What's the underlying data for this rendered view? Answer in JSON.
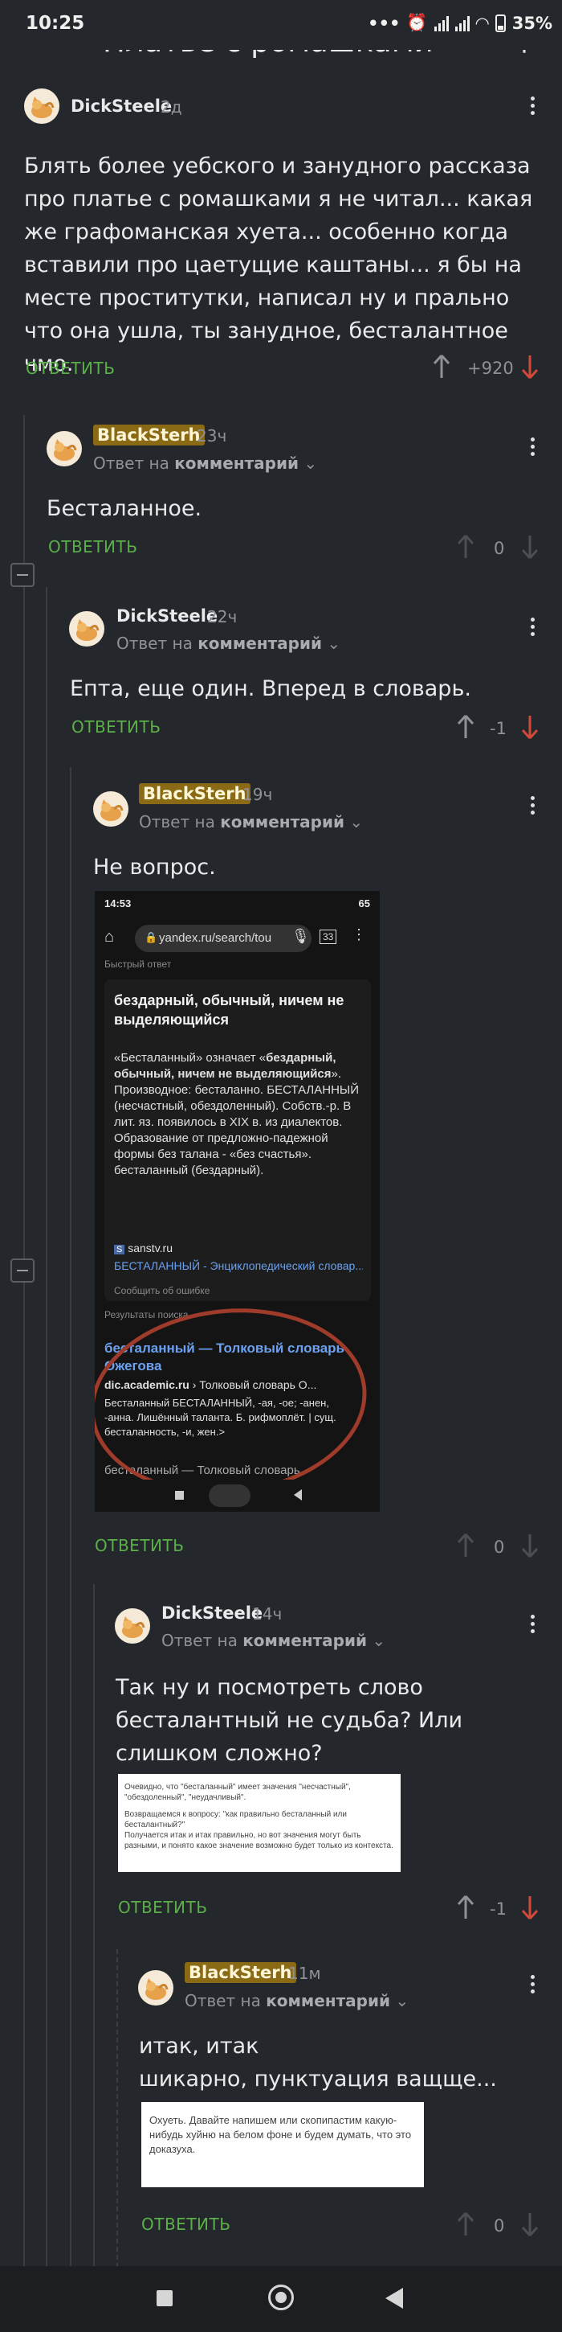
{
  "status_bar": {
    "time": "10:25",
    "battery": "35%"
  },
  "header": {
    "title": "Платье с ромашками"
  },
  "comments": [
    {
      "user": "DickSteele",
      "age": "2д",
      "reply_to": "",
      "text": "Блять более уебского и занудного рассказа про платье с ромашками я не читал... какая же графоманская хуета... особенно когда вставили про цаетущие каштаны... я бы на месте проститутки, написал ну и прально что она ушла, ты занудное, бесталантное чмо.",
      "reply_label": "ОТВЕТИТЬ",
      "votes": "+920"
    },
    {
      "user": "BlackSterh",
      "age": "23ч",
      "reply_to": "Ответ на",
      "reply_to_target": "комментарий",
      "text": "Бесталанное.",
      "reply_label": "ОТВЕТИТЬ",
      "votes": "0"
    },
    {
      "user": "DickSteele",
      "age": "22ч",
      "reply_to": "Ответ на",
      "reply_to_target": "комментарий",
      "text": "Епта, еще один. Вперед в словарь.",
      "reply_label": "ОТВЕТИТЬ",
      "votes": "-1"
    },
    {
      "user": "BlackSterh",
      "age": "19ч",
      "reply_to": "Ответ на",
      "reply_to_target": "комментарий",
      "text": "Не вопрос.",
      "reply_label": "ОТВЕТИТЬ",
      "votes": "0"
    },
    {
      "user": "DickSteele",
      "age": "14ч",
      "reply_to": "Ответ на",
      "reply_to_target": "комментарий",
      "text": "Так ну и посмотреть слово бесталантный не судьба? Или слишком сложно?",
      "reply_label": "ОТВЕТИТЬ",
      "votes": "-1"
    },
    {
      "user": "BlackSterh",
      "age": "11м",
      "reply_to": "Ответ на",
      "reply_to_target": "комментарий",
      "text_line1": "итак, итак",
      "text_line2": "шикарно, пунктуация ващще...",
      "reply_label": "ОТВЕТИТЬ",
      "votes": "0"
    }
  ],
  "embedded_screenshot": {
    "time": "14:53",
    "battery": "65",
    "url": "yandex.ru/search/tou",
    "quick_answer": "Быстрый ответ",
    "heading": "бездарный, обычный, ничем не выделяющийся",
    "body_part1": "«Бесталанный» означает «",
    "body_bold": "бездарный, обычный, ничем не выделяющийся",
    "body_part2": "». Производное: бесталанно. БЕСТАЛАННЫЙ (несчастный, обездоленный). Собств.-р. В лит. яз. появилось в XIX в. из диалектов. Образование от предложно-падежной формы без талана - «без счастья». бесталанный (бездарный).",
    "source_site": "sanstv.ru",
    "source_link": "БЕСТАЛАННЫЙ - Энциклопедический словар...",
    "report": "Сообщить об ошибке",
    "results_header": "Результаты поиска",
    "result_title": "бесталанный — Толковый словарь Ожегова",
    "result_site": "dic.academic.ru",
    "result_crumb": "› Толковый словарь О...",
    "result_snippet": "Бесталанный БЕСТАЛАННЫЙ, -ая, -ое; -анен, -анна. Лишённый таланта. Б. рифмоплёт. | сущ. бесталанность, -и, жен.>",
    "next_result": "бесталанный — Толковый словарь"
  },
  "image2": {
    "line1": "Очевидно, что \"бесталанный\" имеет значения \"несчастный\", \"обездоленный\", \"неудачливый\".",
    "line2": "Возвращаемся к вопросу: \"как правильно бесталанный или бесталантный?\"",
    "line3": "Получается итак и итак правильно, но вот значения могут быть разными, и понято какое значение возможно будет только из контекста."
  },
  "image3": {
    "text": "Охуеть. Давайте напишем или скопипастим какую-нибудь хуйню на белом фоне и будем думать, что это доказуха."
  },
  "colors": {
    "background": "#24272b",
    "reply_green": "#5bb04a",
    "downvote_red": "#d34a3a",
    "badge": "#8a6a14"
  }
}
